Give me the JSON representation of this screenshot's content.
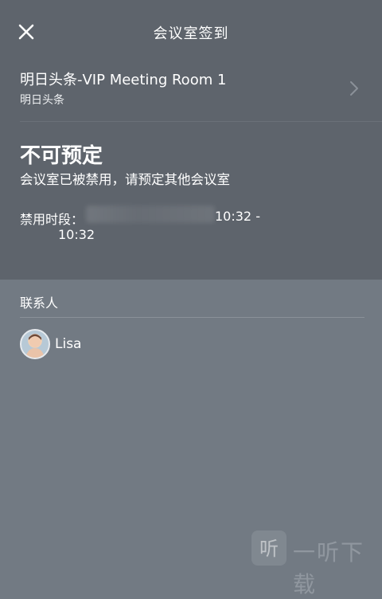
{
  "header": {
    "title": "会议室签到",
    "close_icon": "close-icon"
  },
  "room": {
    "name": "明日头条-VIP Meeting Room 1",
    "subtitle": "明日头条",
    "chevron_icon": "chevron-right-icon"
  },
  "status": {
    "title": "不可预定",
    "description": "会议室已被禁用，请预定其他会议室",
    "ban_label": "禁用时段：",
    "ban_start": "10:32 -",
    "ban_end": "10:32"
  },
  "contacts": {
    "label": "联系人",
    "items": [
      {
        "name": "Lisa",
        "avatar": "avatar-photo"
      }
    ]
  },
  "watermark": {
    "text": "一听下载",
    "icon_glyph": "听"
  },
  "colors": {
    "top_panel": "#5e646c",
    "bottom_panel": "#727a83",
    "text": "#ffffff"
  }
}
